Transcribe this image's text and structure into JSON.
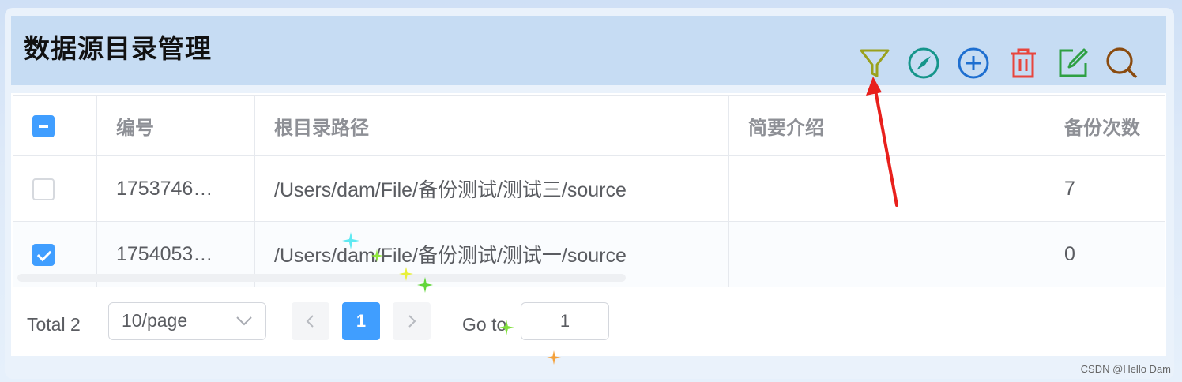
{
  "header": {
    "title": "数据源目录管理",
    "tools": [
      {
        "name": "filter-icon",
        "color": "#9aa11c"
      },
      {
        "name": "compass-icon",
        "color": "#15958a"
      },
      {
        "name": "add-icon",
        "color": "#1e6fd0"
      },
      {
        "name": "delete-icon",
        "color": "#e8453c"
      },
      {
        "name": "edit-icon",
        "color": "#2ea043"
      },
      {
        "name": "search-icon",
        "color": "#8a4b0f"
      }
    ]
  },
  "table": {
    "columns": [
      "编号",
      "根目录路径",
      "简要介绍",
      "备份次数"
    ],
    "rows": [
      {
        "id": "1753746…",
        "path": "/Users/dam/File/备份测试/测试三/source",
        "intro": "",
        "backups": "7",
        "checked": false
      },
      {
        "id": "1754053…",
        "path": "/Users/dam/File/备份测试/测试一/source",
        "intro": "",
        "backups": "0",
        "checked": true
      }
    ]
  },
  "pagination": {
    "total": "Total 2",
    "page_size": "10/page",
    "current_page": "1",
    "goto_label": "Go to",
    "goto_value": "1"
  },
  "watermark": "CSDN @Hello Dam",
  "colors": {
    "accent": "#409eff",
    "header_bg": "#c6dcf3",
    "annotation_arrow": "#e8201c"
  }
}
